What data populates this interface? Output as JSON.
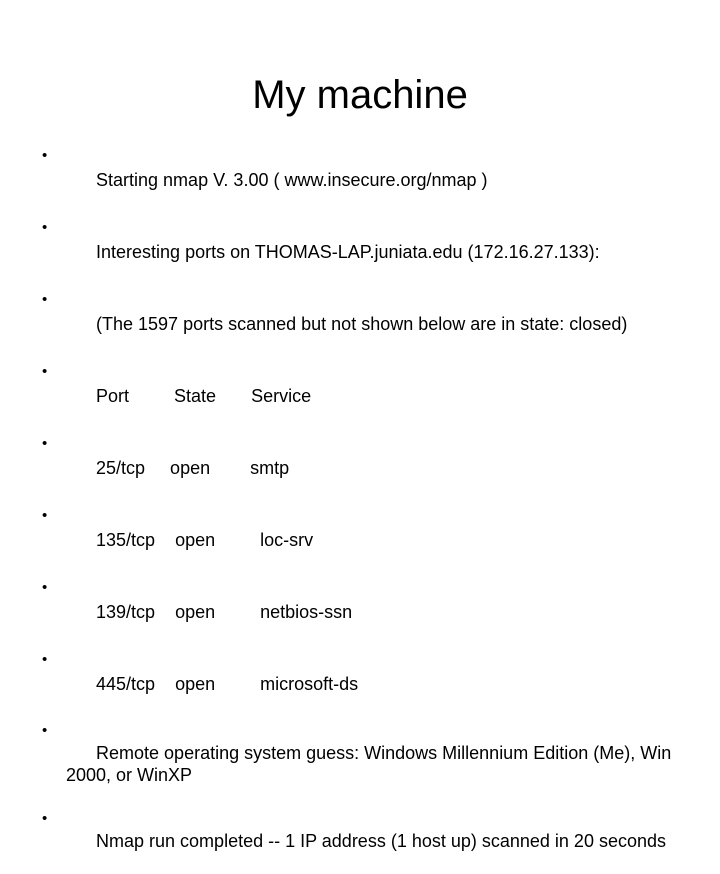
{
  "slide": {
    "title": "My machine",
    "background_color": "#ffffff",
    "text_color": "#000000",
    "bullets": [
      {
        "id": "starting-nmap",
        "text": "Starting nmap V. 3.00 ( www.insecure.org/nmap )",
        "wraps": false,
        "preserve_spacing": false
      },
      {
        "id": "interesting-ports",
        "text": "Interesting ports on THOMAS-LAP.juniata.edu (172.16.27.133):",
        "wraps": false,
        "preserve_spacing": false
      },
      {
        "id": "closed-ports-note",
        "text": "(The 1597 ports scanned but not shown below are in state: closed)",
        "wraps": false,
        "preserve_spacing": false
      },
      {
        "id": "port-table-header",
        "text": "Port         State       Service",
        "wraps": false,
        "preserve_spacing": true
      },
      {
        "id": "port-25-tcp",
        "text": "25/tcp     open        smtp",
        "wraps": false,
        "preserve_spacing": true
      },
      {
        "id": "port-135-tcp",
        "text": "135/tcp    open         loc-srv",
        "wraps": false,
        "preserve_spacing": true
      },
      {
        "id": "port-139-tcp",
        "text": "139/tcp    open         netbios-ssn",
        "wraps": false,
        "preserve_spacing": true
      },
      {
        "id": "port-445-tcp",
        "text": "445/tcp    open         microsoft-ds",
        "wraps": false,
        "preserve_spacing": true
      },
      {
        "id": "os-guess",
        "text": "Remote operating system guess: Windows Millennium Edition (Me), Win 2000, or WinXP",
        "wraps": true,
        "preserve_spacing": false
      },
      {
        "id": "nmap-run-completed",
        "text": "Nmap run completed -- 1 IP address (1 host up) scanned in 20 seconds",
        "wraps": true,
        "preserve_spacing": false
      }
    ],
    "scan_details": {
      "tool": "nmap",
      "version": "V. 3.00",
      "source_url": "www.insecure.org/nmap",
      "host": "THOMAS-LAP.juniata.edu",
      "ip_address": "172.16.27.133",
      "closed_ports_count": "1597",
      "closed_ports_state": "closed",
      "columns": [
        "Port",
        "State",
        "Service"
      ],
      "ports": [
        {
          "port": "25/tcp",
          "state": "open",
          "service": "smtp"
        },
        {
          "port": "135/tcp",
          "state": "open",
          "service": "loc-srv"
        },
        {
          "port": "139/tcp",
          "state": "open",
          "service": "netbios-ssn"
        },
        {
          "port": "445/tcp",
          "state": "open",
          "service": "microsoft-ds"
        }
      ],
      "os_guess": "Windows Millennium Edition (Me), Win 2000, or WinXP",
      "ip_addresses_scanned": "1",
      "hosts_up": "1",
      "scan_duration_seconds": "20"
    }
  }
}
